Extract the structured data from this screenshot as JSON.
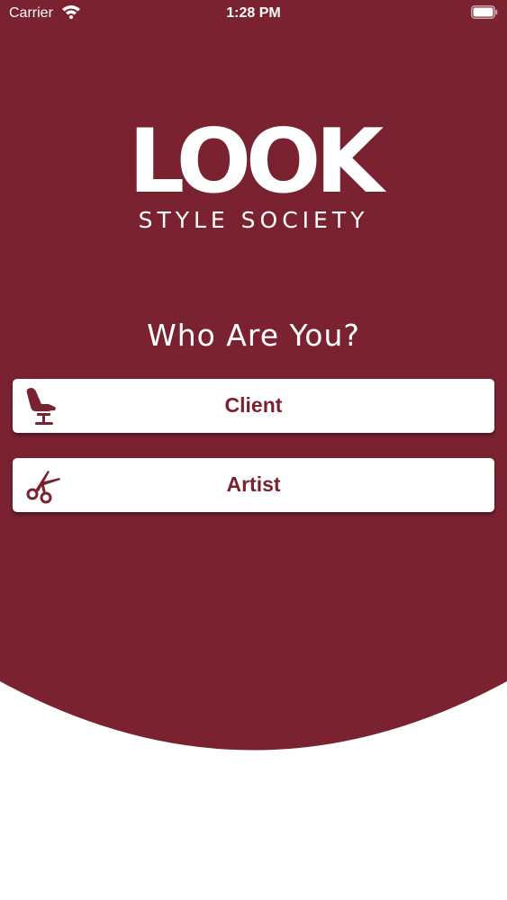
{
  "status_bar": {
    "carrier": "Carrier",
    "time": "1:28 PM"
  },
  "brand": {
    "logo_text": "LOOK",
    "tagline": "STYLE SOCIETY"
  },
  "prompt": "Who Are You?",
  "roles": [
    {
      "label": "Client",
      "icon": "salon-chair-icon"
    },
    {
      "label": "Artist",
      "icon": "scissors-icon"
    }
  ],
  "colors": {
    "background": "#7a2230",
    "button_bg": "#ffffff",
    "button_text": "#7a2230"
  }
}
